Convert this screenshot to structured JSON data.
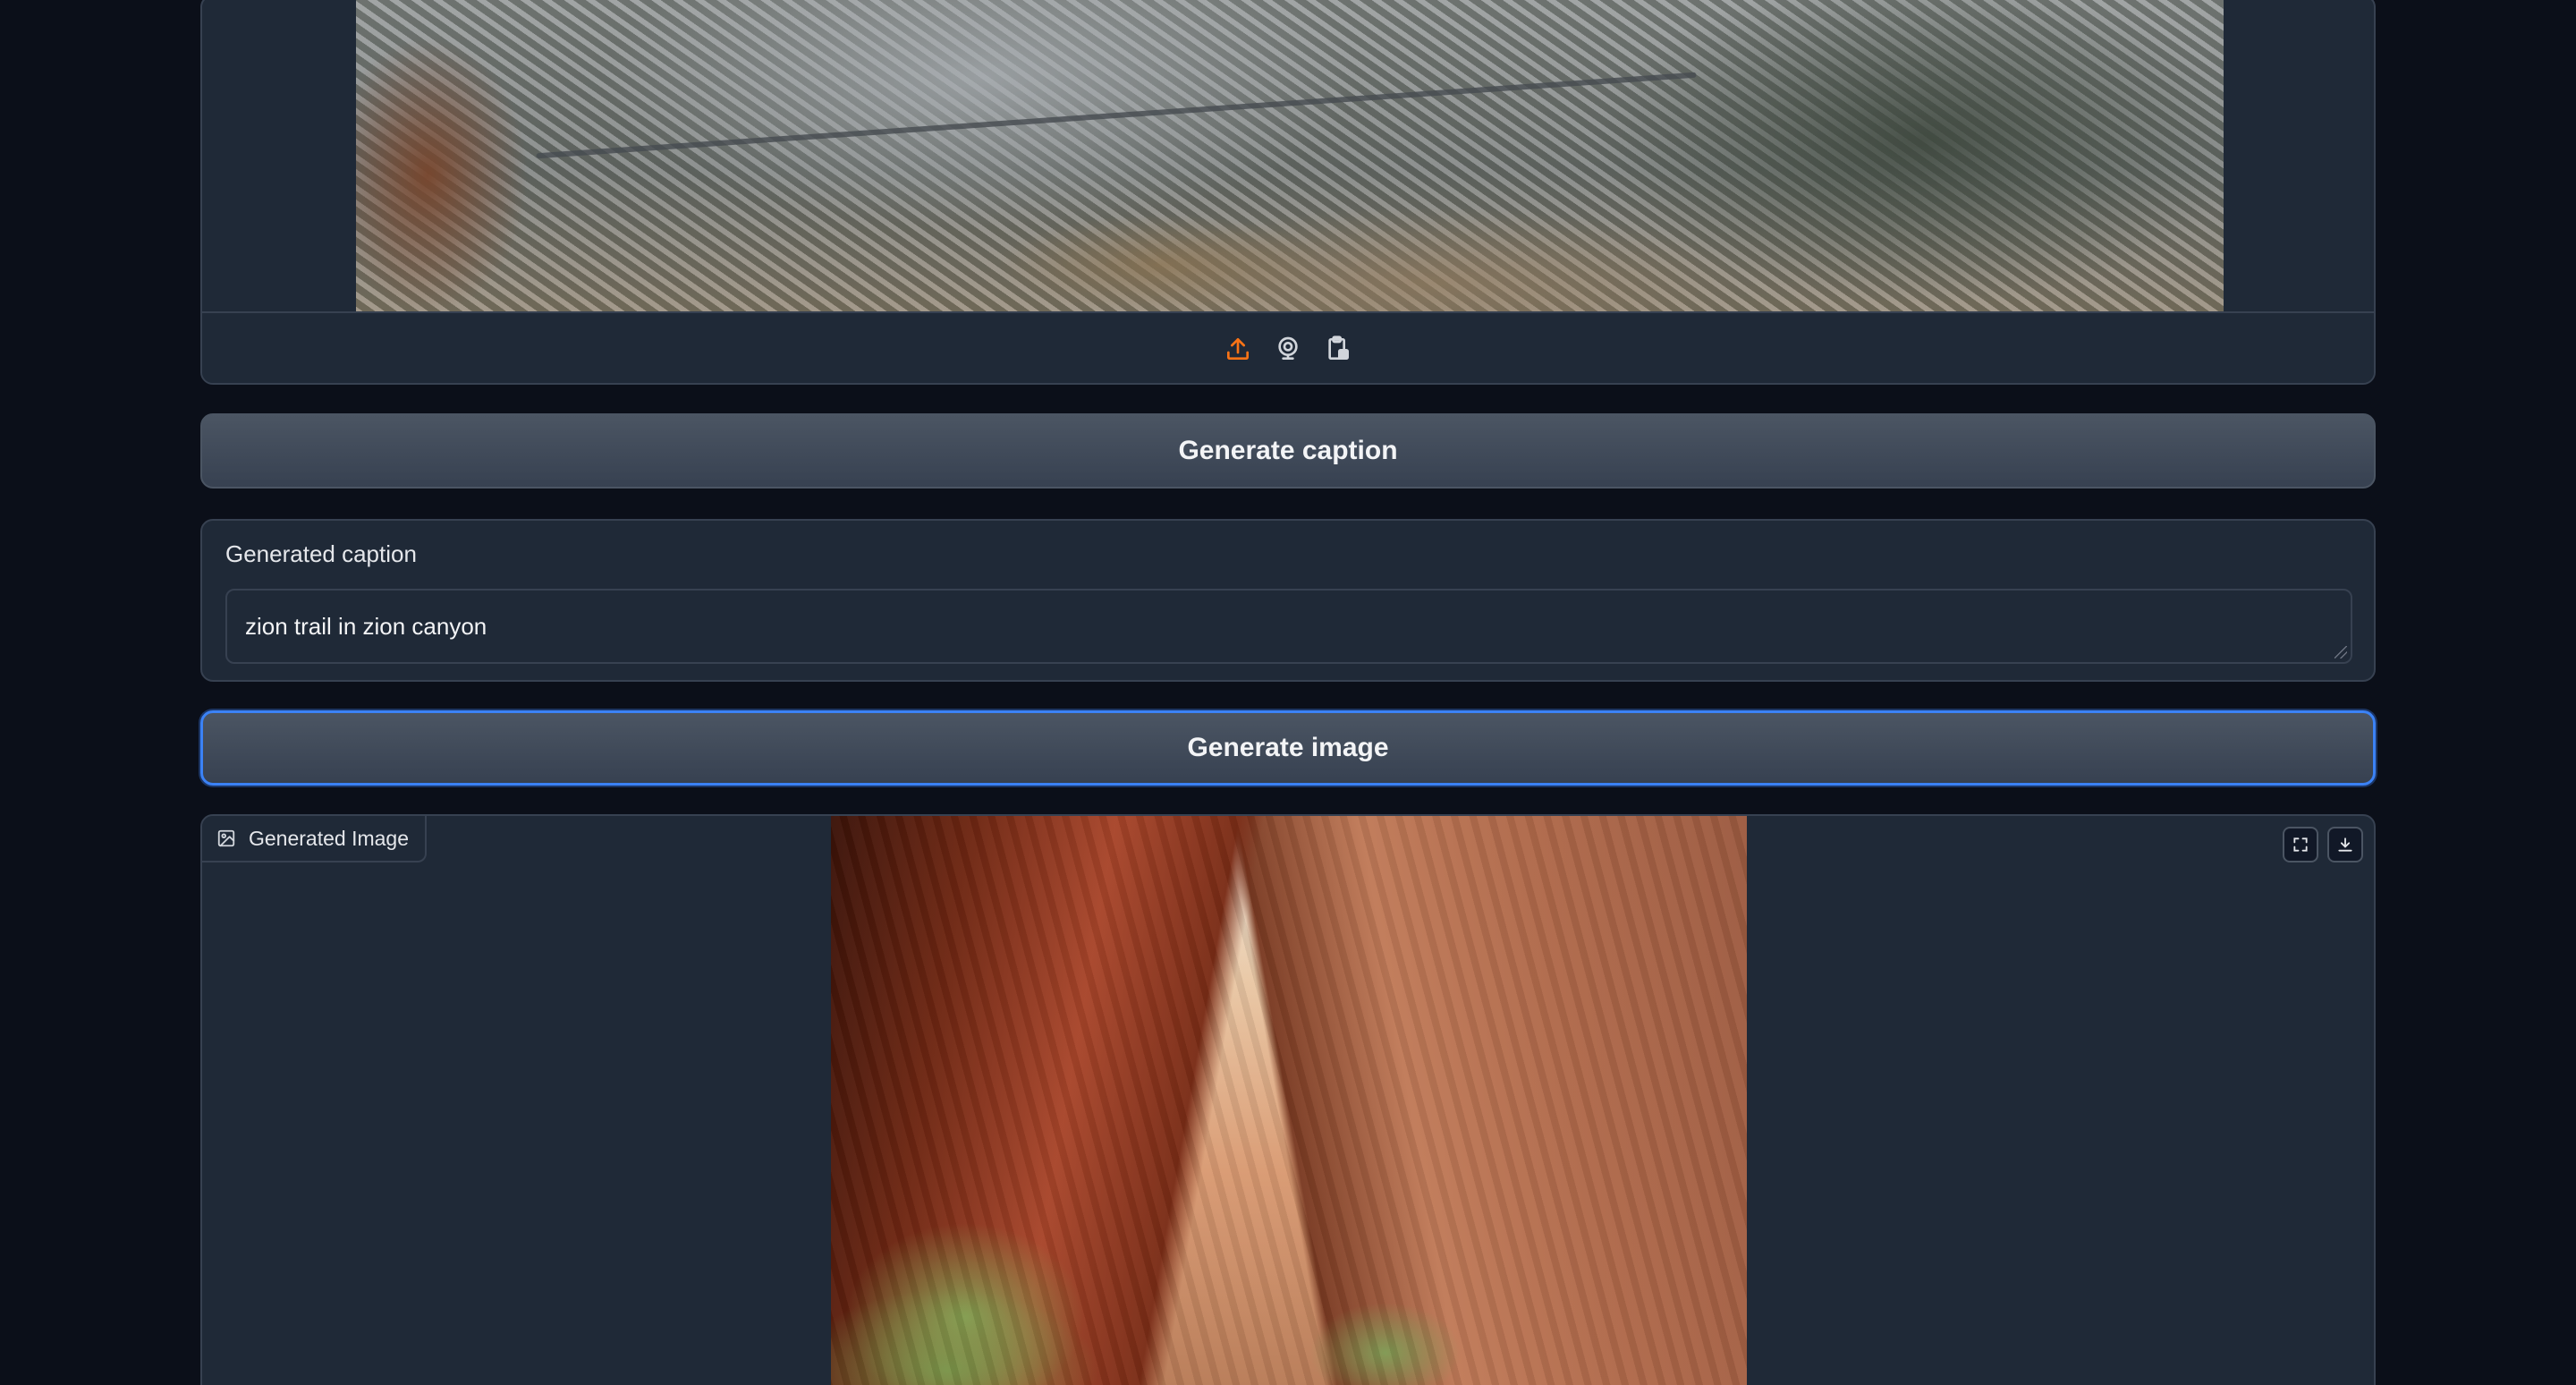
{
  "input_panel": {
    "toolbar": {
      "icons": [
        "upload-icon",
        "webcam-icon",
        "clipboard-icon"
      ]
    }
  },
  "buttons": {
    "generate_caption": "Generate caption",
    "generate_image": "Generate image"
  },
  "caption": {
    "label": "Generated caption",
    "value": "zion trail in zion canyon"
  },
  "output_panel": {
    "label": "Generated Image",
    "actions": [
      "fullscreen-icon",
      "download-icon"
    ]
  },
  "colors": {
    "accent_orange": "#f97316",
    "focus_blue": "#3b82f6",
    "background": "#0b0f19",
    "panel": "#1f2937"
  }
}
